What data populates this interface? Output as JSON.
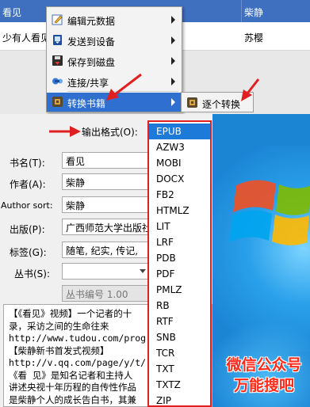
{
  "list": {
    "header": {
      "title_col": "看见",
      "author_col": "柴静"
    },
    "row": {
      "title": "少有人看见",
      "author": "苏樱"
    }
  },
  "context_menu": {
    "items": [
      {
        "label": "编辑元数据",
        "icon": "edit-metadata-icon"
      },
      {
        "label": "发送到设备",
        "icon": "send-device-icon"
      },
      {
        "label": "保存到磁盘",
        "icon": "save-disk-icon"
      },
      {
        "label": "连接/共享",
        "icon": "connect-share-icon"
      },
      {
        "label": "转换书籍",
        "icon": "convert-book-icon"
      }
    ],
    "submenu": {
      "label": "逐个转换",
      "icon": "convert-book-icon"
    }
  },
  "dialog": {
    "output_format_label": "输出格式(O):",
    "title_label": "书名(T):",
    "title_value": "看见",
    "author_label": "作者(A):",
    "author_value": "柴静",
    "author_sort_label": "Author sort:",
    "author_sort_value": "柴静",
    "publisher_label": "出版(P):",
    "publisher_value": "广西师范大学出版社",
    "tags_label": "标签(G):",
    "tags_value": "随笔, 纪实, 传记,",
    "series_label": "丛书(S):",
    "series_value": "",
    "series_number_placeholder": "丛书编号 1.00",
    "comments": [
      "【《看见》视频】一个记者的十",
      "录，采访之间的生命往来",
      "http://www.tudou.com/prog",
      "【柴静新书首发式视频】",
      "http://v.qq.com/page/y/t/",
      "《看  见》是知名记者和主持人",
      "讲述央视十年历程的自传性作品",
      "是柴静个人的成长告白书，其兼"
    ]
  },
  "format_dropdown": {
    "selected": "EPUB",
    "options": [
      "EPUB",
      "AZW3",
      "MOBI",
      "DOCX",
      "FB2",
      "HTMLZ",
      "LIT",
      "LRF",
      "PDB",
      "PDF",
      "PMLZ",
      "RB",
      "RTF",
      "SNB",
      "TCR",
      "TXT",
      "TXTZ",
      "ZIP"
    ]
  },
  "watermark": {
    "line1": "微信公众号",
    "line2": "万能搜吧"
  },
  "colors": {
    "accent_blue": "#2f6fd0",
    "annotation_red": "#e02020",
    "desktop_blue": "#1b85d4"
  }
}
